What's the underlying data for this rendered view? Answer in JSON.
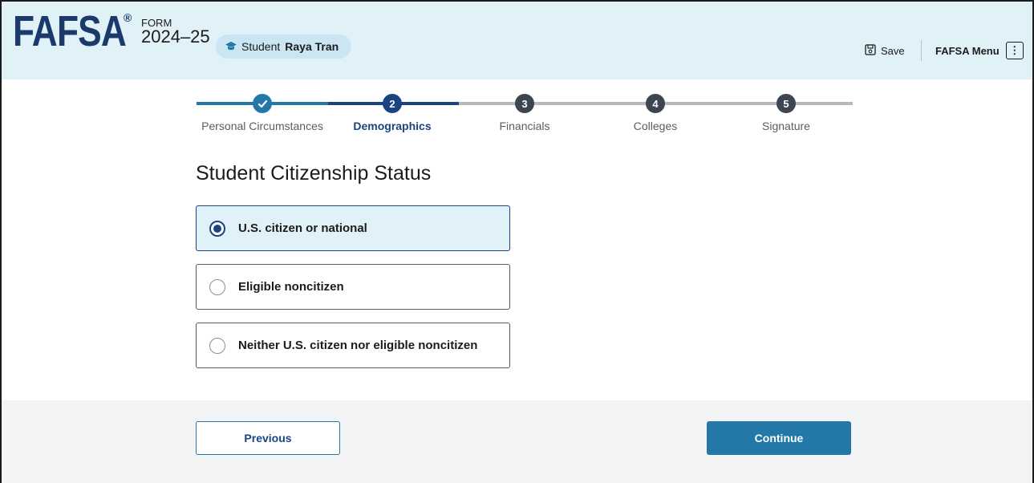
{
  "header": {
    "logo": "FAFSA",
    "logo_mark": "®",
    "form_label": "FORM",
    "form_year": "2024–25",
    "student_prefix": "Student",
    "student_name": "Raya Tran",
    "save_label": "Save",
    "menu_label": "FAFSA Menu",
    "menu_glyph": "⋮"
  },
  "stepper": {
    "steps": [
      {
        "number": "✓",
        "label": "Personal Circumstances",
        "state": "complete"
      },
      {
        "number": "2",
        "label": "Demographics",
        "state": "current"
      },
      {
        "number": "3",
        "label": "Financials",
        "state": "upcoming"
      },
      {
        "number": "4",
        "label": "Colleges",
        "state": "upcoming"
      },
      {
        "number": "5",
        "label": "Signature",
        "state": "upcoming"
      }
    ]
  },
  "main": {
    "title": "Student Citizenship Status",
    "options": [
      {
        "label": "U.S. citizen or national",
        "selected": true
      },
      {
        "label": "Eligible noncitizen",
        "selected": false
      },
      {
        "label": "Neither U.S. citizen nor eligible noncitizen",
        "selected": false
      }
    ]
  },
  "footer": {
    "previous_label": "Previous",
    "continue_label": "Continue"
  },
  "colors": {
    "header_bg": "#e1f1f8",
    "brand_navy": "#1b3a6b",
    "complete": "#2378a8",
    "current": "#1a4480",
    "upcoming": "#3d4551",
    "track_upcoming": "#b8b8b8",
    "button": "#2378a8"
  },
  "icons": {
    "student": "student-cap-icon",
    "save": "save-disk-icon",
    "menu": "vertical-dots-icon",
    "complete_step": "checkmark-icon"
  }
}
